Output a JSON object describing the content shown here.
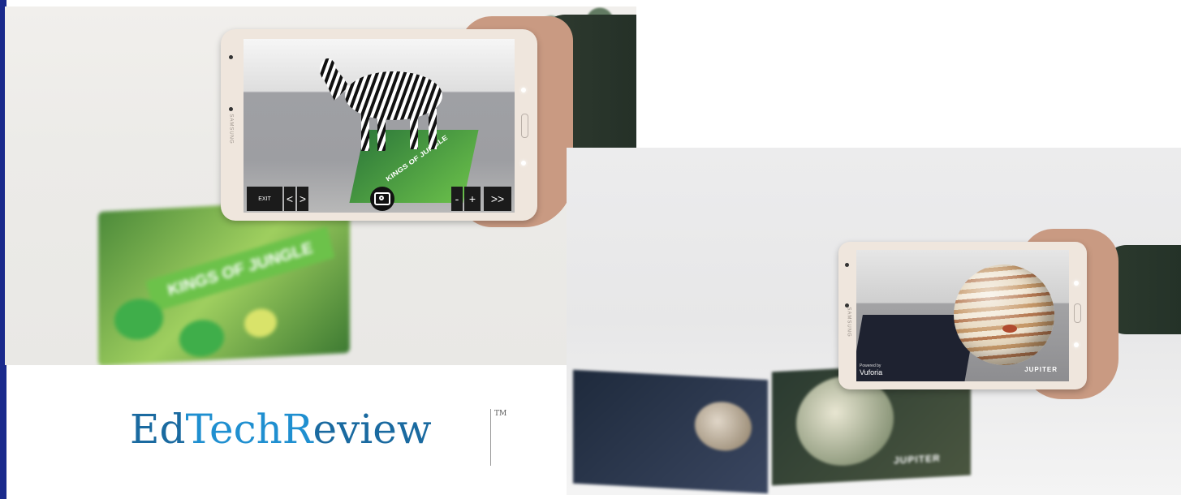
{
  "photo_left": {
    "toolbar": {
      "exit_label": "EXIT",
      "prev_label": "<",
      "next_label": ">",
      "camera_icon": "camera-icon",
      "minus_label": "-",
      "plus_label": "+",
      "forward_label": ">>"
    },
    "tablet_brand": "SAMSUNG",
    "booklet_title": "KINGS OF JUNGLE",
    "mat_title": "KINGS OF JUNGLE"
  },
  "photo_right": {
    "powered_by": "Powered by",
    "vuforia": "Vuforia",
    "screen_label": "JUPITER",
    "book_label": "JUPITER",
    "tablet_brand": "SAMSUNG"
  },
  "logo": {
    "part1": "Ed",
    "part2": "Tech",
    "part3": "R",
    "part4": "eview",
    "tm": "TM"
  },
  "colors": {
    "edge_bar": "#1a2a8c",
    "logo_blue": "#1a6aa0",
    "logo_lightblue": "#1f8fd0"
  }
}
